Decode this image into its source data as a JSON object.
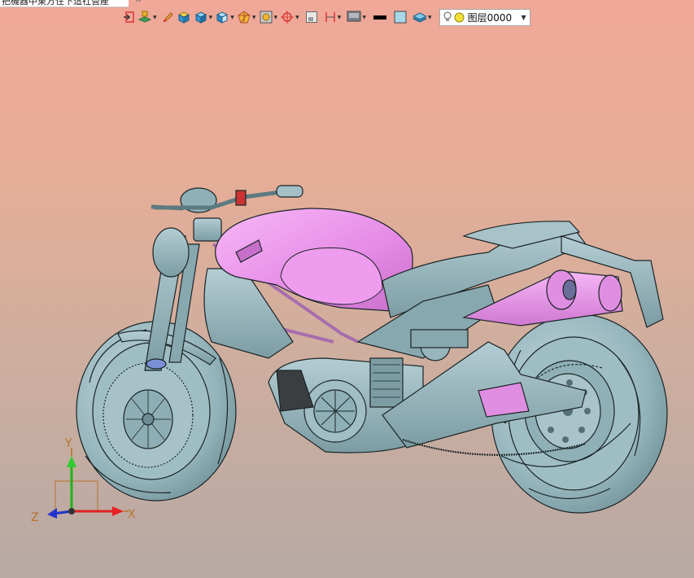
{
  "window": {
    "tab_title": "把機器中東方住下這社營產"
  },
  "toolbar": {
    "layer_select": {
      "value": "图层0000"
    },
    "buttons": [
      "exit-icon",
      "layer-manage-icon",
      "pencil-icon",
      "cube-shade-icon",
      "solid-cube-icon",
      "view-cube-icon",
      "sphere-icon",
      "snap-icon",
      "target-icon",
      "frame-icon",
      "height-icon",
      "display-icon",
      "line-color-icon",
      "fill-color-icon",
      "layer-stack-icon"
    ]
  },
  "triad": {
    "x_label": "X",
    "y_label": "Y",
    "z_label": "Z"
  },
  "colors": {
    "body": "#95b6bd",
    "tank": "#e78ee8",
    "edge": "#1a2426",
    "bg_top": "#f0a898",
    "bg_bottom": "#b7a9a4"
  }
}
